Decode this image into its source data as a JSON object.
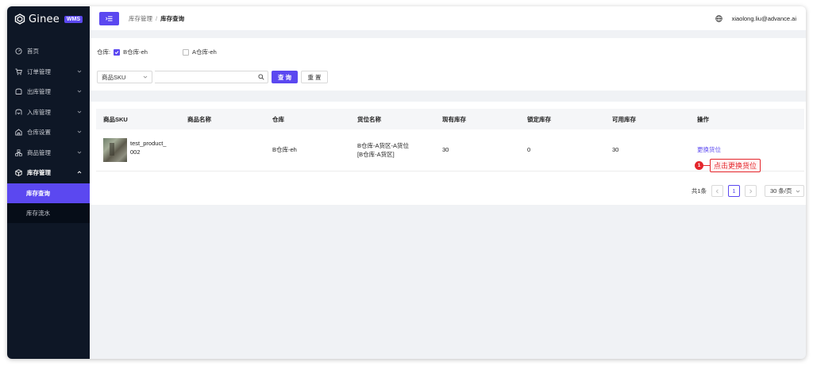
{
  "brand": {
    "name": "Ginee",
    "badge": "WMS",
    "accent": "#5b48f0"
  },
  "sidebar": {
    "items": [
      {
        "label": "首页",
        "icon": "dashboard-icon"
      },
      {
        "label": "订单管理",
        "icon": "cart-icon"
      },
      {
        "label": "出库管理",
        "icon": "outbound-icon"
      },
      {
        "label": "入库管理",
        "icon": "inbound-icon"
      },
      {
        "label": "仓库设置",
        "icon": "warehouse-icon"
      },
      {
        "label": "商品管理",
        "icon": "product-icon"
      },
      {
        "label": "库存管理",
        "icon": "inventory-icon"
      }
    ],
    "sub_items": [
      {
        "label": "库存查询"
      },
      {
        "label": "库存流水"
      }
    ]
  },
  "topbar": {
    "breadcrumb": [
      "库存管理",
      "库存查询"
    ],
    "separator": "/",
    "user": "xiaolong.liu@advance.ai"
  },
  "filters": {
    "warehouse_label": "仓库:",
    "warehouses": [
      {
        "label": "B仓库-eh",
        "checked": true
      },
      {
        "label": "A仓库-eh",
        "checked": false
      }
    ],
    "field_select": "商品SKU",
    "search_value": "",
    "search_button": "查 询",
    "reset_button": "重 置"
  },
  "table": {
    "columns": [
      "商品SKU",
      "商品名称",
      "仓库",
      "货位名称",
      "现有库存",
      "锁定库存",
      "可用库存",
      "操作"
    ],
    "rows": [
      {
        "sku": "test_product_002",
        "name": "",
        "warehouse": "B仓库-eh",
        "location_line1": "B仓库-A货区-A货位",
        "location_line2": "[B仓库-A货区]",
        "on_hand": "30",
        "locked": "0",
        "available": "30",
        "action": "更换货位"
      }
    ]
  },
  "pagination": {
    "total": "共1条",
    "current": "1",
    "page_size": "30 条/页"
  },
  "callout": {
    "step": "1",
    "text": "点击更换货位"
  }
}
